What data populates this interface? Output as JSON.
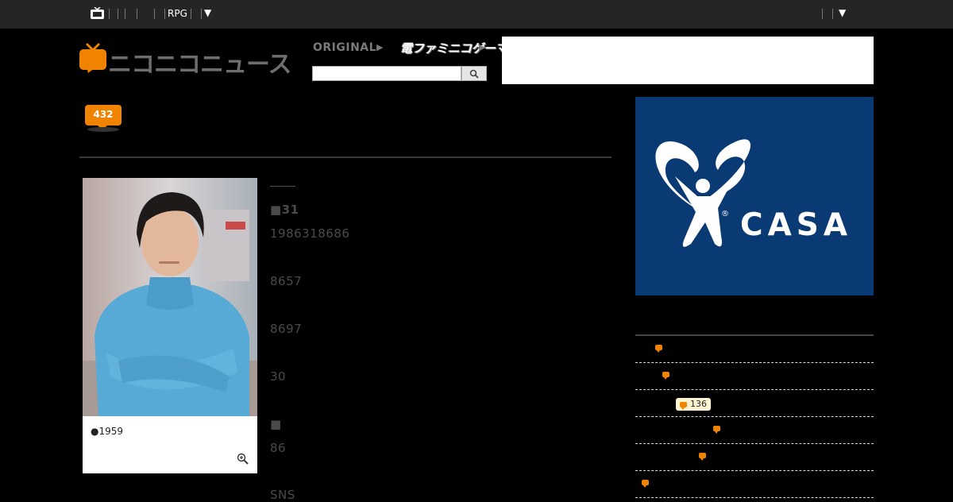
{
  "topbar": {
    "game_label": "RPG",
    "menu_toggle": "▼",
    "account_toggle": "▼"
  },
  "header": {
    "site_name": "ニコニコニュース",
    "original_label": "ORIGINAL",
    "denfami_label": "電ファミニコゲーマー",
    "search": {
      "value": "",
      "placeholder": ""
    }
  },
  "article": {
    "comment_count": "432",
    "photo_caption": "●1959",
    "section_marker_1": "■31",
    "lines": [
      "1986318686",
      "8657",
      "8697",
      "30"
    ],
    "section_marker_2": "■",
    "more_lines": [
      "86",
      "SNS"
    ]
  },
  "sidebar": {
    "ad_brand": "CASA",
    "ad_registered": "®",
    "ranking": [
      {
        "comment_count": ""
      },
      {
        "comment_count": ""
      },
      {
        "comment_count": "136"
      },
      {
        "comment_count": ""
      },
      {
        "comment_count": ""
      },
      {
        "comment_count": ""
      }
    ]
  },
  "colors": {
    "accent": "#f08300",
    "background": "#000000",
    "topbar": "#252525",
    "ad_blue": "#0a3a73"
  }
}
